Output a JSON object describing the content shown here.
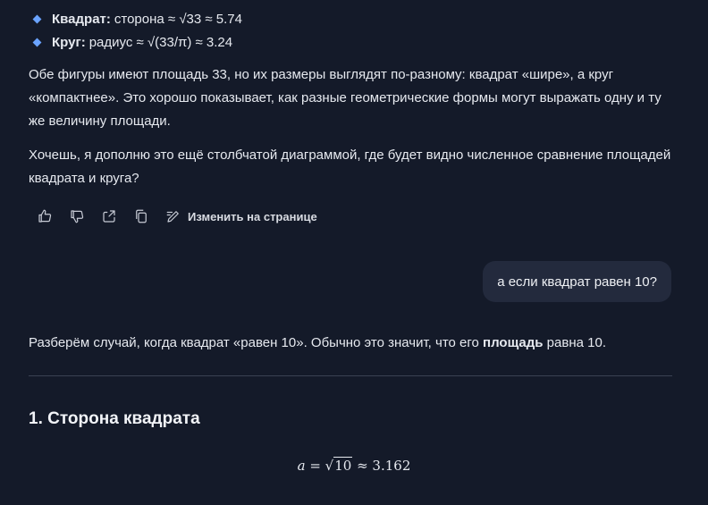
{
  "bullets": [
    {
      "label": "Квадрат:",
      "text": "сторона ≈ √33 ≈ 5.74"
    },
    {
      "label": "Круг:",
      "text": "радиус ≈ √(33/π) ≈ 3.24"
    }
  ],
  "para1": "Обе фигуры имеют площадь 33, но их размеры выглядят по-разному: квадрат «шире», а круг «компактнее». Это хорошо показывает, как разные геометрические формы могут выражать одну и ту же величину площади.",
  "para2": "Хочешь, я дополню это ещё столбчатой диаграммой, где будет видно численное сравнение площадей квадрата и круга?",
  "actions": {
    "like": "thumbs-up-icon",
    "dislike": "thumbs-down-icon",
    "share": "share-icon",
    "copy": "copy-icon",
    "edit_label": "Изменить на странице"
  },
  "user_message": "а если квадрат равен 10?",
  "reply": {
    "p_before": "Разберём случай, когда квадрат «равен 10». Обычно это значит, что его ",
    "p_bold": "площадь",
    "p_after": " равна 10.",
    "heading": "1. Сторона квадрата",
    "formula_var": "a",
    "formula_eq": " = ",
    "formula_root": "√",
    "formula_radicand": "10",
    "formula_approx": " ≈ 3.162"
  }
}
